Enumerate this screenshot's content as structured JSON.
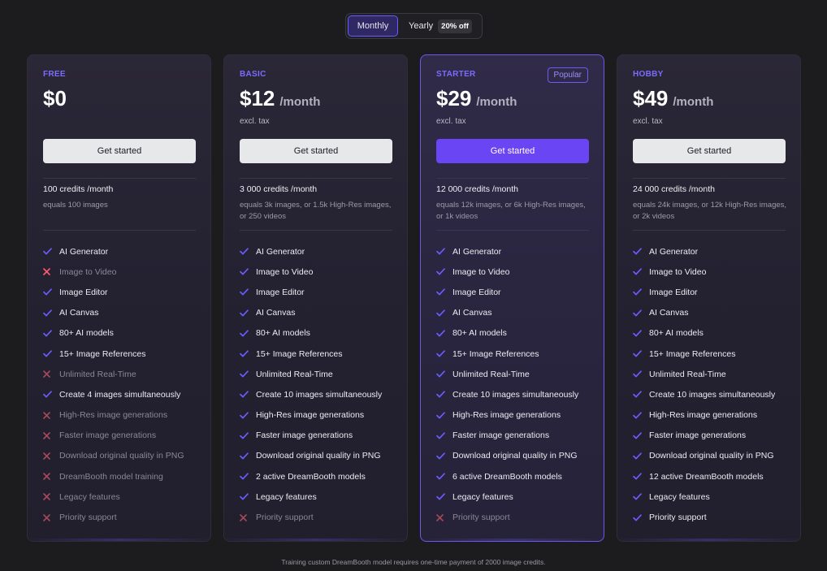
{
  "billing_toggle": {
    "monthly_label": "Monthly",
    "yearly_label": "Yearly",
    "yearly_discount": "20% off",
    "selected": "Monthly"
  },
  "colors": {
    "accent": "#6a45f3",
    "check": "#6a5cff",
    "cross_active": "#ff5a6e",
    "cross_muted": "#a44a58"
  },
  "plans": [
    {
      "name": "FREE",
      "price": "$0",
      "period": "",
      "tax_note": "",
      "cta_label": "Get started",
      "credits": "100 credits /month",
      "credits_note": "equals 100 images",
      "features": [
        {
          "label": "AI Generator",
          "included": true
        },
        {
          "label": "Image to Video",
          "included": false
        },
        {
          "label": "Image Editor",
          "included": true
        },
        {
          "label": "AI Canvas",
          "included": true
        },
        {
          "label": "80+ AI models",
          "included": true
        },
        {
          "label": "15+ Image References",
          "included": true
        },
        {
          "label": "Unlimited Real-Time",
          "included": false
        },
        {
          "label": "Create 4 images simultaneously",
          "included": true
        },
        {
          "label": "High-Res image generations",
          "included": false
        },
        {
          "label": "Faster image generations",
          "included": false
        },
        {
          "label": "Download original quality in PNG",
          "included": false
        },
        {
          "label": "DreamBooth model training",
          "included": false
        },
        {
          "label": "Legacy features",
          "included": false
        },
        {
          "label": "Priority support",
          "included": false
        }
      ]
    },
    {
      "name": "BASIC",
      "price": "$12",
      "period": "/month",
      "tax_note": "excl. tax",
      "cta_label": "Get started",
      "credits": "3 000 credits /month",
      "credits_note": "equals 3k images, or 1.5k High-Res images, or 250 videos",
      "features": [
        {
          "label": "AI Generator",
          "included": true
        },
        {
          "label": "Image to Video",
          "included": true
        },
        {
          "label": "Image Editor",
          "included": true
        },
        {
          "label": "AI Canvas",
          "included": true
        },
        {
          "label": "80+ AI models",
          "included": true
        },
        {
          "label": "15+ Image References",
          "included": true
        },
        {
          "label": "Unlimited Real-Time",
          "included": true
        },
        {
          "label": "Create 10 images simultaneously",
          "included": true
        },
        {
          "label": "High-Res image generations",
          "included": true
        },
        {
          "label": "Faster image generations",
          "included": true
        },
        {
          "label": "Download original quality in PNG",
          "included": true
        },
        {
          "label": "2 active DreamBooth models",
          "included": true
        },
        {
          "label": "Legacy features",
          "included": true
        },
        {
          "label": "Priority support",
          "included": false
        }
      ]
    },
    {
      "name": "STARTER",
      "badge": "Popular",
      "price": "$29",
      "period": "/month",
      "tax_note": "excl. tax",
      "cta_label": "Get started",
      "credits": "12 000 credits /month",
      "credits_note": "equals 12k images, or 6k High-Res images, or 1k videos",
      "features": [
        {
          "label": "AI Generator",
          "included": true
        },
        {
          "label": "Image to Video",
          "included": true
        },
        {
          "label": "Image Editor",
          "included": true
        },
        {
          "label": "AI Canvas",
          "included": true
        },
        {
          "label": "80+ AI models",
          "included": true
        },
        {
          "label": "15+ Image References",
          "included": true
        },
        {
          "label": "Unlimited Real-Time",
          "included": true
        },
        {
          "label": "Create 10 images simultaneously",
          "included": true
        },
        {
          "label": "High-Res image generations",
          "included": true
        },
        {
          "label": "Faster image generations",
          "included": true
        },
        {
          "label": "Download original quality in PNG",
          "included": true
        },
        {
          "label": "6 active DreamBooth models",
          "included": true
        },
        {
          "label": "Legacy features",
          "included": true
        },
        {
          "label": "Priority support",
          "included": false
        }
      ]
    },
    {
      "name": "HOBBY",
      "price": "$49",
      "period": "/month",
      "tax_note": "excl. tax",
      "cta_label": "Get started",
      "credits": "24 000 credits /month",
      "credits_note": "equals 24k images, or 12k High-Res images, or 2k videos",
      "features": [
        {
          "label": "AI Generator",
          "included": true
        },
        {
          "label": "Image to Video",
          "included": true
        },
        {
          "label": "Image Editor",
          "included": true
        },
        {
          "label": "AI Canvas",
          "included": true
        },
        {
          "label": "80+ AI models",
          "included": true
        },
        {
          "label": "15+ Image References",
          "included": true
        },
        {
          "label": "Unlimited Real-Time",
          "included": true
        },
        {
          "label": "Create 10 images simultaneously",
          "included": true
        },
        {
          "label": "High-Res image generations",
          "included": true
        },
        {
          "label": "Faster image generations",
          "included": true
        },
        {
          "label": "Download original quality in PNG",
          "included": true
        },
        {
          "label": "12 active DreamBooth models",
          "included": true
        },
        {
          "label": "Legacy features",
          "included": true
        },
        {
          "label": "Priority support",
          "included": true
        }
      ]
    }
  ],
  "footnote": "Training custom DreamBooth model requires one-time payment of 2000 image credits."
}
